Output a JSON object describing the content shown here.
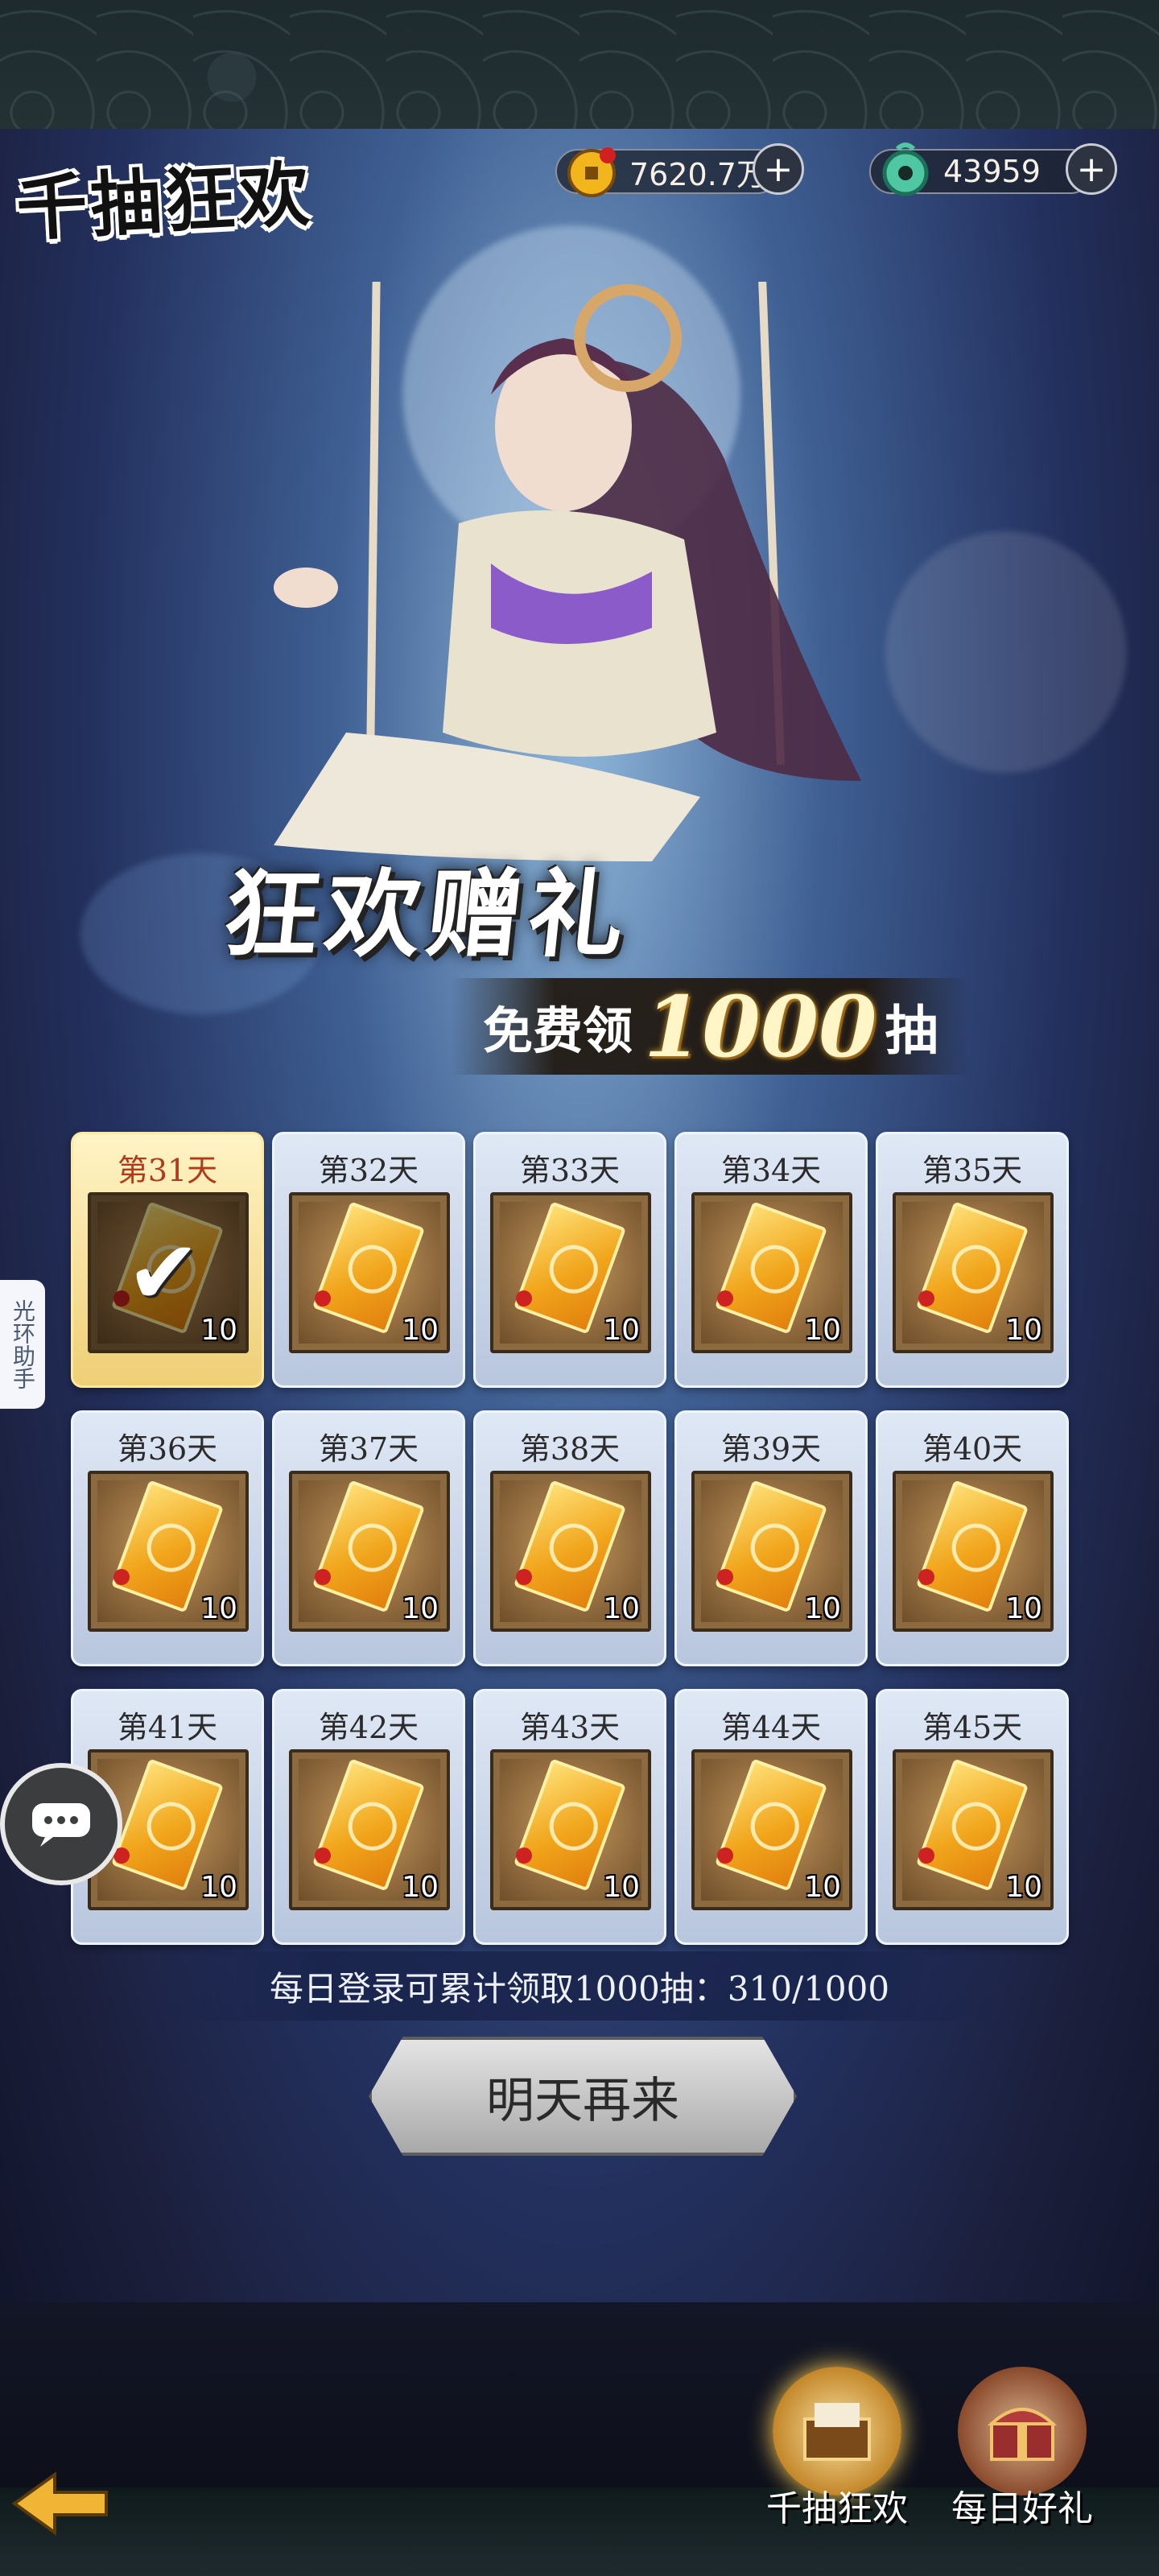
{
  "title": "千抽狂欢",
  "currency": [
    {
      "name": "coins",
      "value": "7620.7万",
      "icon": "coin-icon"
    },
    {
      "name": "jade",
      "value": "43959",
      "icon": "jade-icon"
    }
  ],
  "banner": {
    "line1": "狂欢赠礼",
    "line2_prefix": "免费领",
    "line2_number": "1000",
    "line2_suffix": "抽"
  },
  "rewards": [
    {
      "day": "第31天",
      "qty": "10",
      "claimed": true
    },
    {
      "day": "第32天",
      "qty": "10",
      "claimed": false
    },
    {
      "day": "第33天",
      "qty": "10",
      "claimed": false
    },
    {
      "day": "第34天",
      "qty": "10",
      "claimed": false
    },
    {
      "day": "第35天",
      "qty": "10",
      "claimed": false
    },
    {
      "day": "第36天",
      "qty": "10",
      "claimed": false
    },
    {
      "day": "第37天",
      "qty": "10",
      "claimed": false
    },
    {
      "day": "第38天",
      "qty": "10",
      "claimed": false
    },
    {
      "day": "第39天",
      "qty": "10",
      "claimed": false
    },
    {
      "day": "第40天",
      "qty": "10",
      "claimed": false
    },
    {
      "day": "第41天",
      "qty": "10",
      "claimed": false
    },
    {
      "day": "第42天",
      "qty": "10",
      "claimed": false
    },
    {
      "day": "第43天",
      "qty": "10",
      "claimed": false
    },
    {
      "day": "第44天",
      "qty": "10",
      "claimed": false
    },
    {
      "day": "第45天",
      "qty": "10",
      "claimed": false
    }
  ],
  "progress_text": "每日登录可累计领取1000抽：310/1000",
  "button_label": "明天再来",
  "side_helper": "光环助手",
  "tabs": [
    {
      "label": "千抽狂欢",
      "active": true
    },
    {
      "label": "每日好礼",
      "active": false
    }
  ]
}
